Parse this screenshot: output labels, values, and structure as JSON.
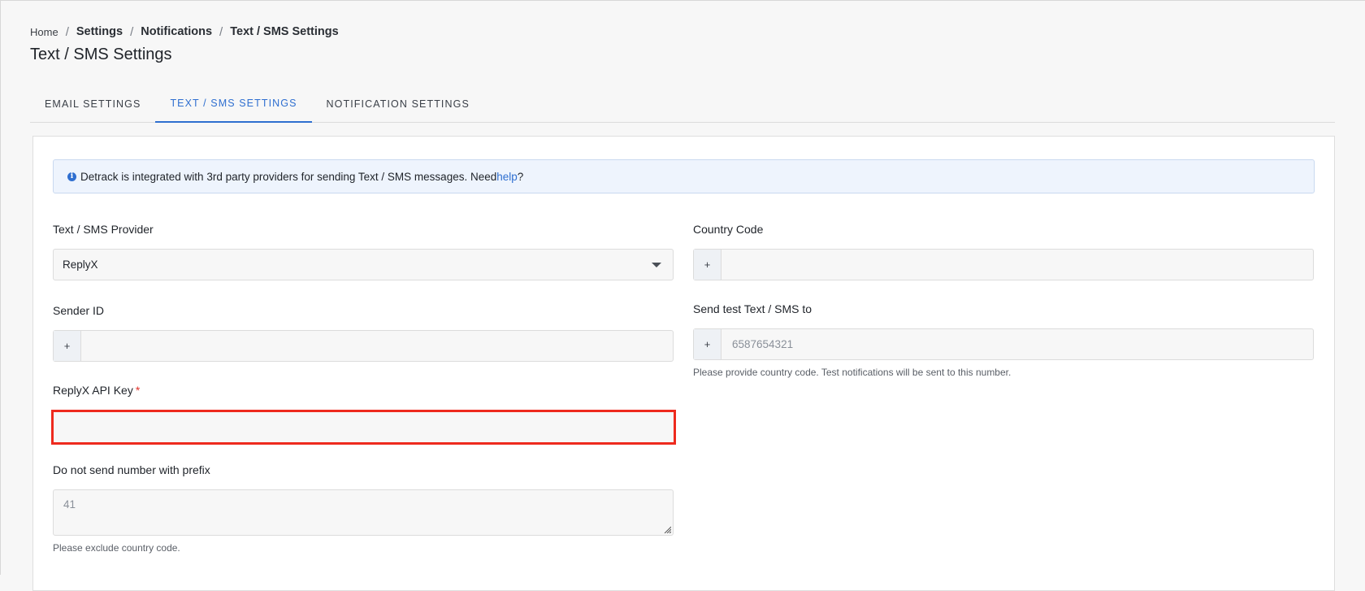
{
  "breadcrumb": {
    "home": "Home",
    "items": [
      "Settings",
      "Notifications",
      "Text / SMS Settings"
    ],
    "separator": "/"
  },
  "page_title": "Text / SMS Settings",
  "tabs": [
    {
      "label": "EMAIL SETTINGS",
      "active": false
    },
    {
      "label": "TEXT / SMS SETTINGS",
      "active": true
    },
    {
      "label": "NOTIFICATION SETTINGS",
      "active": false
    }
  ],
  "info": {
    "icon": "info-icon",
    "text": "Detrack is integrated with 3rd party providers for sending Text / SMS messages. Need ",
    "link": "help",
    "suffix": "?"
  },
  "form": {
    "provider": {
      "label": "Text / SMS Provider",
      "value": "ReplyX"
    },
    "country_code": {
      "label": "Country Code",
      "prefix": "+",
      "value": ""
    },
    "sender_id": {
      "label": "Sender ID",
      "prefix": "+",
      "value": ""
    },
    "test_sms": {
      "label": "Send test Text / SMS to",
      "prefix": "+",
      "placeholder": "6587654321",
      "help": "Please provide country code. Test notifications will be sent to this number."
    },
    "api_key": {
      "label": "ReplyX API Key",
      "required_mark": "*",
      "value": ""
    },
    "no_prefix": {
      "label": "Do not send number with prefix",
      "placeholder": "41",
      "help": "Please exclude country code."
    }
  },
  "colors": {
    "accent": "#2f6fd0",
    "highlight_border": "#ee2a1e",
    "required": "#e0322a"
  }
}
